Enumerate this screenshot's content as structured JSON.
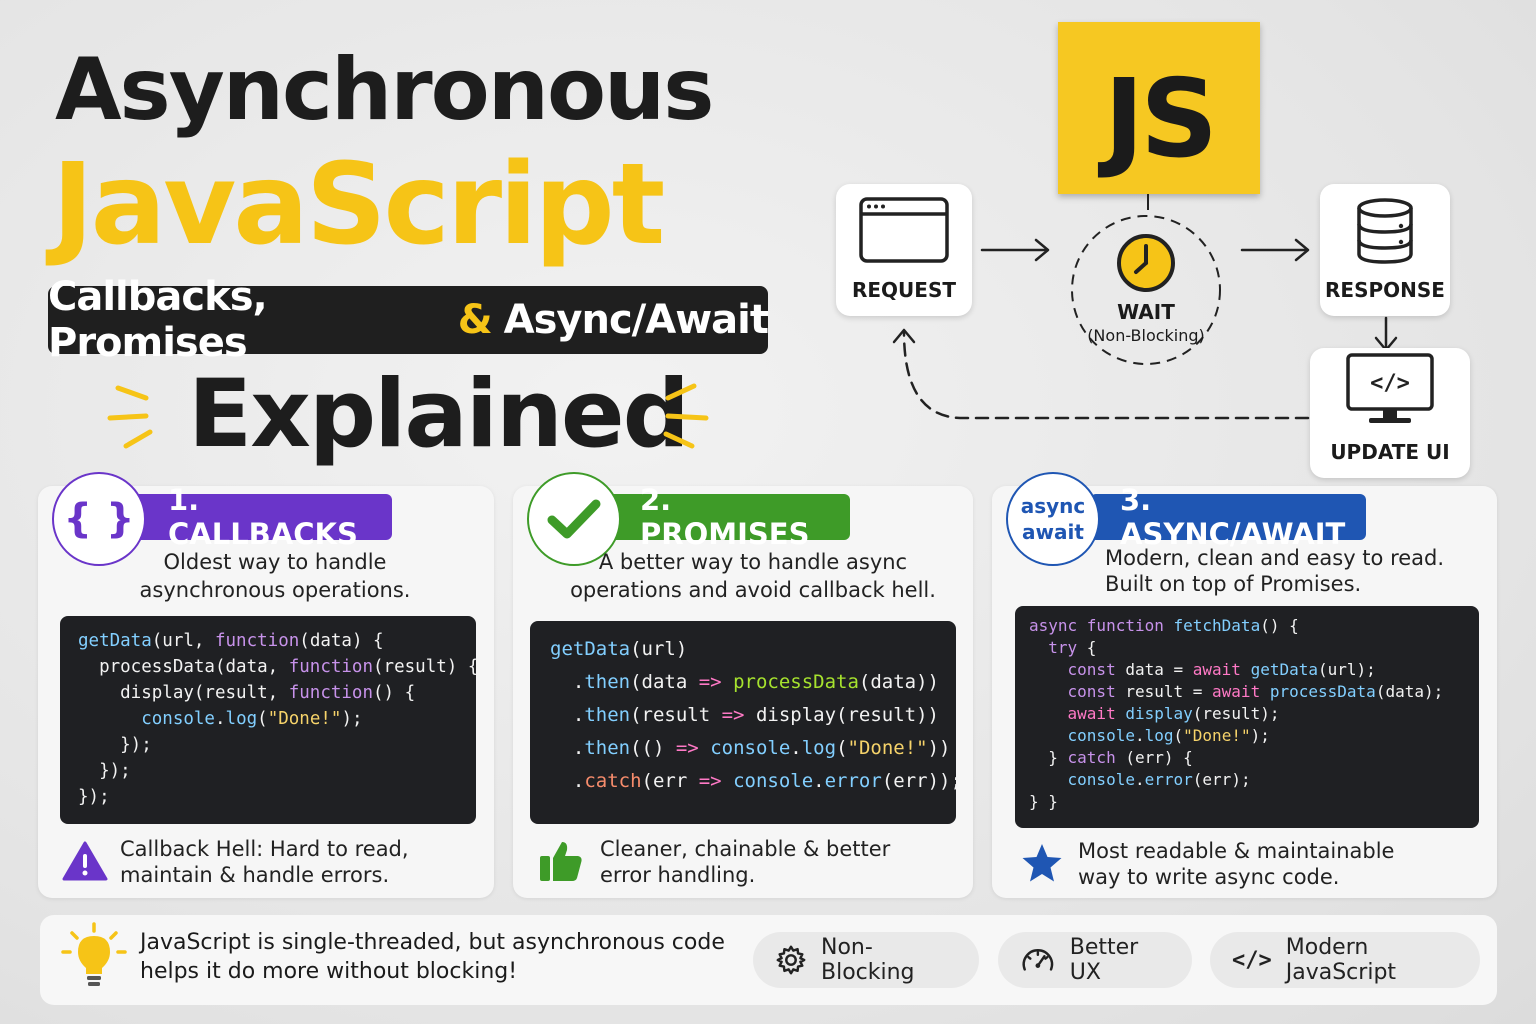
{
  "title": {
    "line1": "Asynchronous",
    "line2": "JavaScript",
    "subtitle_part1": "Callbacks, Promises",
    "subtitle_amp": "&",
    "subtitle_part2": "Async/Await",
    "line4": "Explained"
  },
  "js_logo": "JS",
  "flow": {
    "request": "REQUEST",
    "wait": "WAIT",
    "wait_sub": "(Non-Blocking)",
    "response": "RESPONSE",
    "update_ui": "UPDATE UI"
  },
  "cards": [
    {
      "icon_text": "{ }",
      "label": "1. CALLBACKS",
      "color": "#6a35c9",
      "desc_line1": "Oldest way to handle",
      "desc_line2": "asynchronous operations.",
      "note_line1": "Callback Hell: Hard to read,",
      "note_line2": "maintain & handle errors."
    },
    {
      "label": "2. PROMISES",
      "color": "#3e9b28",
      "desc_line1": "A better way to handle async",
      "desc_line2": "operations and avoid callback hell.",
      "note_line1": "Cleaner, chainable & better",
      "note_line2": "error handling."
    },
    {
      "icon_line1": "async",
      "icon_line2": "await",
      "label": "3. ASYNC/AWAIT",
      "color": "#1f56b3",
      "desc_line1": "Modern, clean and easy to read.",
      "desc_line2": "Built on top of Promises.",
      "note_line1": "Most readable & maintainable",
      "note_line2": "way to write async code."
    }
  ],
  "code": {
    "callbacks": [
      "getData(url, function(data) {",
      "  processData(data, function(result) {",
      "    display(result, function() {",
      "      console.log(\"Done!\");",
      "    });",
      "  });",
      "});"
    ],
    "promises": [
      "getData(url)",
      "  .then(data => processData(data))",
      "  .then(result => display(result))",
      "  .then(() => console.log(\"Done!\"))",
      "  .catch(err => console.error(err));"
    ],
    "async": [
      "async function fetchData() {",
      "  try {",
      "    const data = await getData(url);",
      "    const result = await processData(data);",
      "    await display(result);",
      "    console.log(\"Done!\");",
      "  } catch (err) {",
      "    console.error(err);",
      "} }"
    ]
  },
  "footer": {
    "line1": "JavaScript is single-threaded, but asynchronous code",
    "line2": "helps it do more without blocking!",
    "pills": [
      {
        "icon": "gear-icon",
        "label": "Non-Blocking"
      },
      {
        "icon": "speedometer-icon",
        "label": "Better UX"
      },
      {
        "icon": "code-icon",
        "label": "Modern JavaScript"
      }
    ]
  },
  "colors": {
    "yellow": "#f6c417",
    "purple": "#6a35c9",
    "green": "#3e9b28",
    "blue": "#1f56b3",
    "dark": "#1f1f1f"
  }
}
